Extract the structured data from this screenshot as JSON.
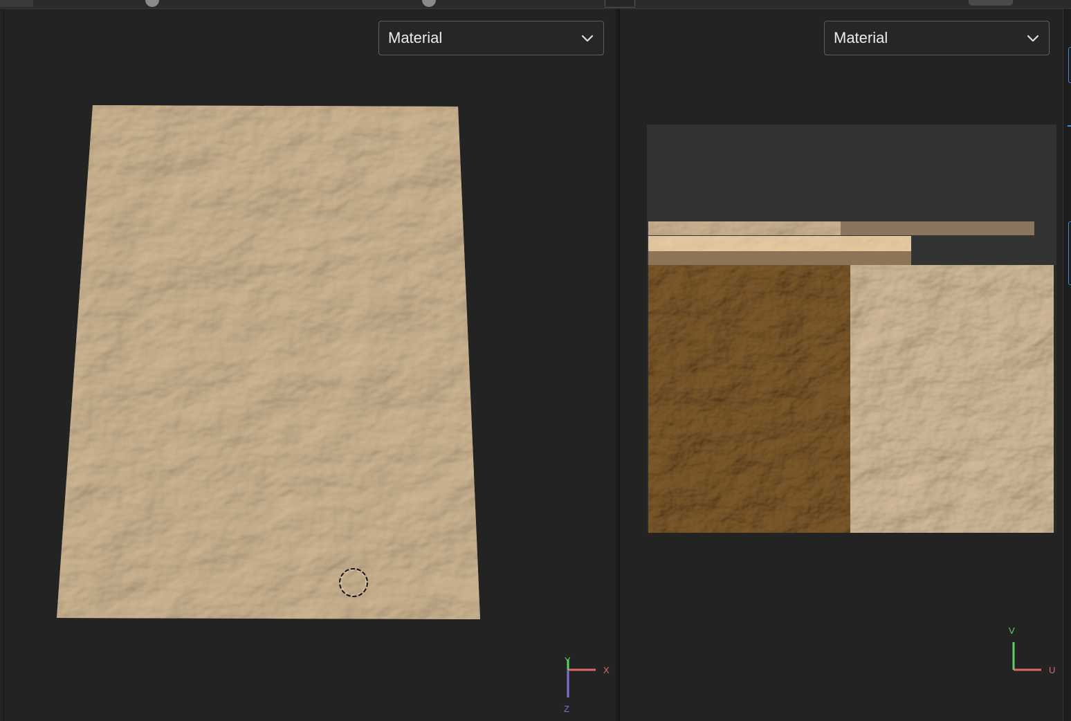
{
  "left_viewport": {
    "dropdown": {
      "value": "Material"
    },
    "gizmo": {
      "x_label": "X",
      "y_label": "Y",
      "z_label": "Z"
    }
  },
  "right_viewport": {
    "dropdown": {
      "value": "Material"
    },
    "gizmo": {
      "u_label": "U",
      "v_label": "V"
    }
  },
  "colors": {
    "background": "#232323",
    "sand_light": "#c7ab86",
    "sand_dark": "#6b4a22",
    "accent_blue": "#3c8dde",
    "axis_x": "#e06a6a",
    "axis_y": "#5ed05e",
    "axis_z": "#7a73d8"
  },
  "icons": [
    "chevron-down-icon",
    "brush-cursor-icon",
    "axis-gizmo-icon",
    "uv-axis-gizmo-icon"
  ]
}
